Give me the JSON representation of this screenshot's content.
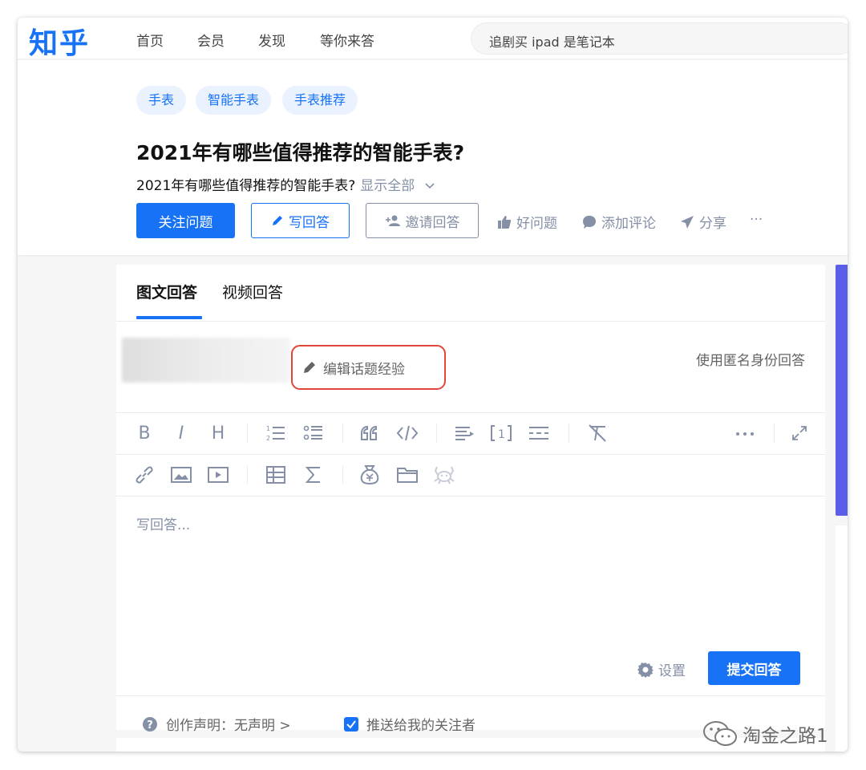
{
  "nav": {
    "logo": "知乎",
    "items": [
      "首页",
      "会员",
      "发现",
      "等你来答"
    ],
    "search_text": "追剧买 ipad 是笔记本"
  },
  "question": {
    "tags": [
      "手表",
      "智能手表",
      "手表推荐"
    ],
    "title": "2021年有哪些值得推荐的智能手表?",
    "description": "2021年有哪些值得推荐的智能手表?",
    "show_all": "显示全部",
    "follow_label": "关注问题",
    "write_label": "写回答",
    "invite_label": "邀请回答",
    "good_label": "好问题",
    "comment_label": "添加评论",
    "share_label": "分享",
    "more_label": "···"
  },
  "editor": {
    "tabs": [
      "图文回答",
      "视频回答"
    ],
    "edit_experience": "编辑话题经验",
    "anonymous": "使用匿名身份回答",
    "toolbar_row1": [
      "B",
      "I",
      "H",
      "ordered-list-icon",
      "bullet-list-icon",
      "quote-icon",
      "code-icon",
      "indent-icon",
      "reference-icon",
      "divider-icon",
      "clear-format-icon",
      "more-icon",
      "expand-icon"
    ],
    "toolbar_row2": [
      "link-icon",
      "image-icon",
      "video-icon",
      "table-icon",
      "formula-icon",
      "money-bag-icon",
      "folder-icon",
      "crab-icon"
    ],
    "placeholder": "写回答...",
    "settings_label": "设置",
    "submit_label": "提交回答",
    "creation_statement": "创作声明：无声明 >",
    "push_followers": "推送给我的关注者"
  },
  "watermark": "淘金之路1",
  "colors": {
    "brand": "#1772f6",
    "accent_bar": "#5b5ee8",
    "highlight": "#e0463a"
  }
}
